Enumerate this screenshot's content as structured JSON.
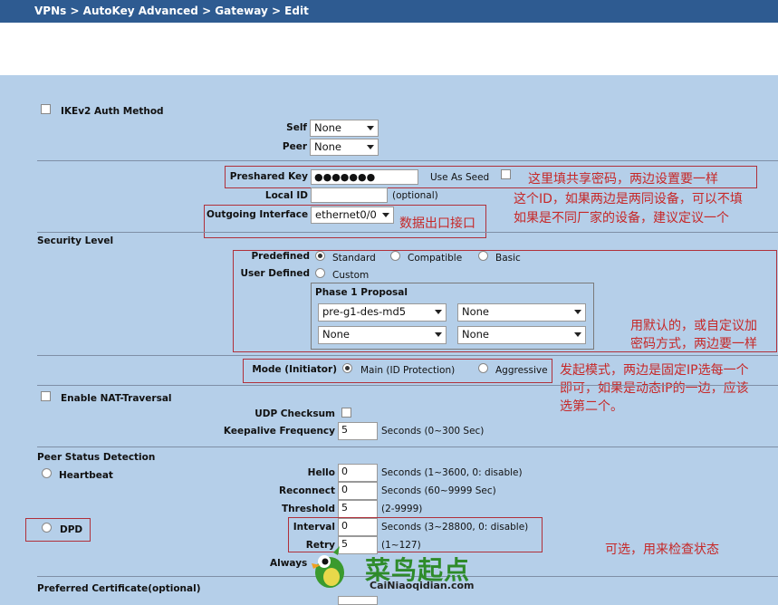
{
  "breadcrumb": "VPNs > AutoKey Advanced > Gateway > Edit",
  "ikev2": {
    "label": "IKEv2 Auth Method",
    "self_label": "Self",
    "self_value": "None",
    "peer_label": "Peer",
    "peer_value": "None"
  },
  "preshared": {
    "label": "Preshared Key",
    "value": "●●●●●●●",
    "use_as_seed": "Use As Seed"
  },
  "local_id": {
    "label": "Local ID",
    "hint": "(optional)"
  },
  "outgoing": {
    "label": "Outgoing Interface",
    "value": "ethernet0/0"
  },
  "security": {
    "heading": "Security Level",
    "predefined": "Predefined",
    "options": [
      "Standard",
      "Compatible",
      "Basic"
    ],
    "user_defined": "User Defined",
    "custom": "Custom",
    "phase1_title": "Phase 1 Proposal",
    "proposals": [
      "pre-g1-des-md5",
      "None",
      "None",
      "None"
    ]
  },
  "mode": {
    "label": "Mode (Initiator)",
    "main": "Main (ID Protection)",
    "aggressive": "Aggressive"
  },
  "nat": {
    "label": "Enable NAT-Traversal",
    "udp_checksum": "UDP Checksum",
    "keepalive_label": "Keepalive Frequency",
    "keepalive_value": "5",
    "keepalive_hint": "Seconds (0~300 Sec)"
  },
  "psd": {
    "heading": "Peer Status Detection",
    "heartbeat": "Heartbeat",
    "hello_label": "Hello",
    "hello_value": "0",
    "hello_hint": "Seconds (1~3600, 0: disable)",
    "reconnect_label": "Reconnect",
    "reconnect_value": "0",
    "reconnect_hint": "Seconds (60~9999 Sec)",
    "threshold_label": "Threshold",
    "threshold_value": "5",
    "threshold_hint": "(2-9999)",
    "dpd": "DPD",
    "interval_label": "Interval",
    "interval_value": "0",
    "interval_hint": "Seconds (3~28800, 0: disable)",
    "retry_label": "Retry",
    "retry_value": "5",
    "retry_hint": "(1~127)",
    "always_label": "Always"
  },
  "pref_cert": "Preferred Certificate(optional)",
  "notes": {
    "psk": "这里填共享密码，两边设置要一样",
    "localid_1": "这个ID，如果两边是两同设备，可以不填",
    "localid_2": "如果是不同厂家的设备，建议定议一个",
    "outgoing": "数据出口接口",
    "proposal_1": "用默认的，或自定议加",
    "proposal_2": "密码方式，两边要一样",
    "mode_1": "发起模式，两边是固定IP选每一个",
    "mode_2": "即可，如果是动态IP的一边，应该",
    "mode_3": "选第二个。",
    "dpd": "可选，用来检查状态"
  },
  "watermark": {
    "text": "菜鸟起点",
    "url": "CaiNiaoqidian.com"
  },
  "colors": {
    "topbar": "#2e5b91",
    "panel": "#b5cfe9",
    "annotation": "#c62828",
    "logo_green": "#2e8b2a"
  }
}
